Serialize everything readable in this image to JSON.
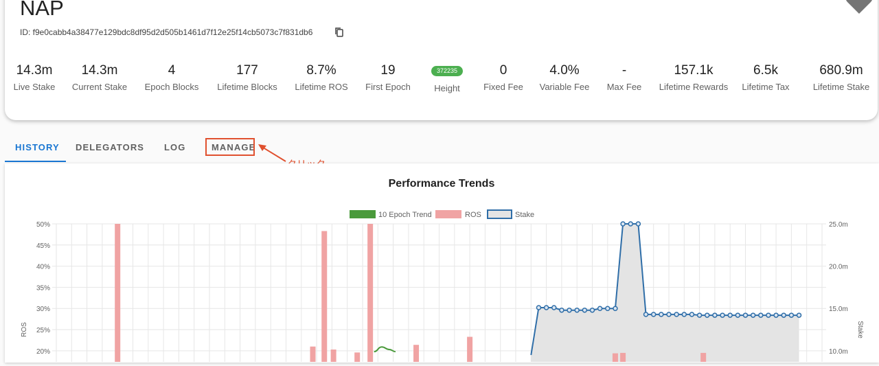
{
  "pool": {
    "name": "NAP",
    "id_text": "ID: f9e0cabb4a38477e129bdc8df95d2d505b1461d7f12e25f14cb5073c7f831db6"
  },
  "stats": [
    {
      "value": "14.3m",
      "label": "Live Stake"
    },
    {
      "value": "14.3m",
      "label": "Current Stake"
    },
    {
      "value": "4",
      "label": "Epoch Blocks"
    },
    {
      "value": "177",
      "label": "Lifetime Blocks"
    },
    {
      "value": "8.7%",
      "label": "Lifetime ROS"
    },
    {
      "value": "19",
      "label": "First Epoch"
    },
    {
      "value": "372235",
      "label": "Height"
    },
    {
      "value": "0",
      "label": "Fixed Fee"
    },
    {
      "value": "4.0%",
      "label": "Variable Fee"
    },
    {
      "value": "-",
      "label": "Max Fee"
    },
    {
      "value": "157.1k",
      "label": "Lifetime Rewards"
    },
    {
      "value": "6.5k",
      "label": "Lifetime Tax"
    },
    {
      "value": "680.9m",
      "label": "Lifetime Stake"
    }
  ],
  "tabs": [
    "HISTORY",
    "DELEGATORS",
    "LOG",
    "MANAGE"
  ],
  "annotation": {
    "text": "クリック"
  },
  "colors": {
    "accent": "#1976d2",
    "badge": "#4caf50",
    "annotation": "#e0502e",
    "trend": "#4a9a3b",
    "ros": "#f0a3a3",
    "stake": "#2f6ea8"
  },
  "chart_data": {
    "type": "bar",
    "title": "Performance Trends",
    "legend": [
      "10 Epoch Trend",
      "ROS",
      "Stake"
    ],
    "legend_position": "top",
    "ylabel_left": "ROS",
    "ylabel_right": "Stake",
    "y_ticks_left": [
      "50%",
      "45%",
      "40%",
      "35%",
      "30%",
      "25%",
      "20%"
    ],
    "y_ticks_right": [
      "25.0m",
      "20.0m",
      "15.0m",
      "10.0m"
    ],
    "ylim_left": [
      19,
      50
    ],
    "ylim_right": [
      9.5,
      25
    ],
    "grid": true,
    "ros_bars": [
      {
        "x": 8,
        "value": 50
      },
      {
        "x": 33.5,
        "value": 21
      },
      {
        "x": 35,
        "value": 48.3
      },
      {
        "x": 36.2,
        "value": 20.3
      },
      {
        "x": 39.3,
        "value": 19.6
      },
      {
        "x": 41,
        "value": 50
      },
      {
        "x": 47,
        "value": 21.4
      },
      {
        "x": 54,
        "value": 23.3
      },
      {
        "x": 73,
        "value": 19.4
      },
      {
        "x": 74,
        "value": 19.5
      },
      {
        "x": 84.5,
        "value": 19.5
      }
    ],
    "trend_line": [
      {
        "x": 41.5,
        "value": 19.8
      },
      {
        "x": 42.5,
        "value": 20.9
      },
      {
        "x": 43.5,
        "value": 20.3
      },
      {
        "x": 44.3,
        "value": 19.8
      }
    ],
    "stake_series": {
      "x": [
        63,
        64,
        65,
        66,
        67,
        68,
        69,
        70,
        71,
        72,
        73,
        74,
        75,
        76,
        77,
        78,
        79,
        80,
        81,
        82,
        83,
        84,
        85,
        86,
        87,
        88,
        89,
        90,
        91,
        92,
        93,
        94,
        95,
        96,
        97
      ],
      "values": [
        15.1,
        15.1,
        15.1,
        14.8,
        14.8,
        14.8,
        14.8,
        14.8,
        15.0,
        15.0,
        15.0,
        25.0,
        25.0,
        25.0,
        14.3,
        14.3,
        14.3,
        14.3,
        14.3,
        14.3,
        14.3,
        14.2,
        14.2,
        14.2,
        14.2,
        14.2,
        14.2,
        14.2,
        14.2,
        14.2,
        14.2,
        14.2,
        14.2,
        14.2,
        14.2
      ],
      "baseline_start": {
        "x": 62,
        "value": 9.5
      }
    }
  }
}
